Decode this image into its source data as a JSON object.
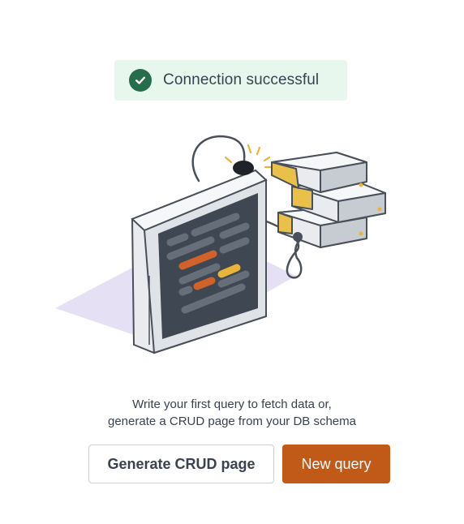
{
  "banner": {
    "icon": "check-circle-icon",
    "text": "Connection successful",
    "background": "#e8f7ee",
    "icon_color": "#256d4b"
  },
  "illustration": {
    "name": "monitor-and-database-illustration"
  },
  "description": {
    "line1": "Write your first query to fetch data or,",
    "line2": "generate a CRUD page from your DB schema"
  },
  "actions": {
    "generate_crud_label": "Generate CRUD page",
    "new_query_label": "New query",
    "primary_color": "#c15a19"
  }
}
